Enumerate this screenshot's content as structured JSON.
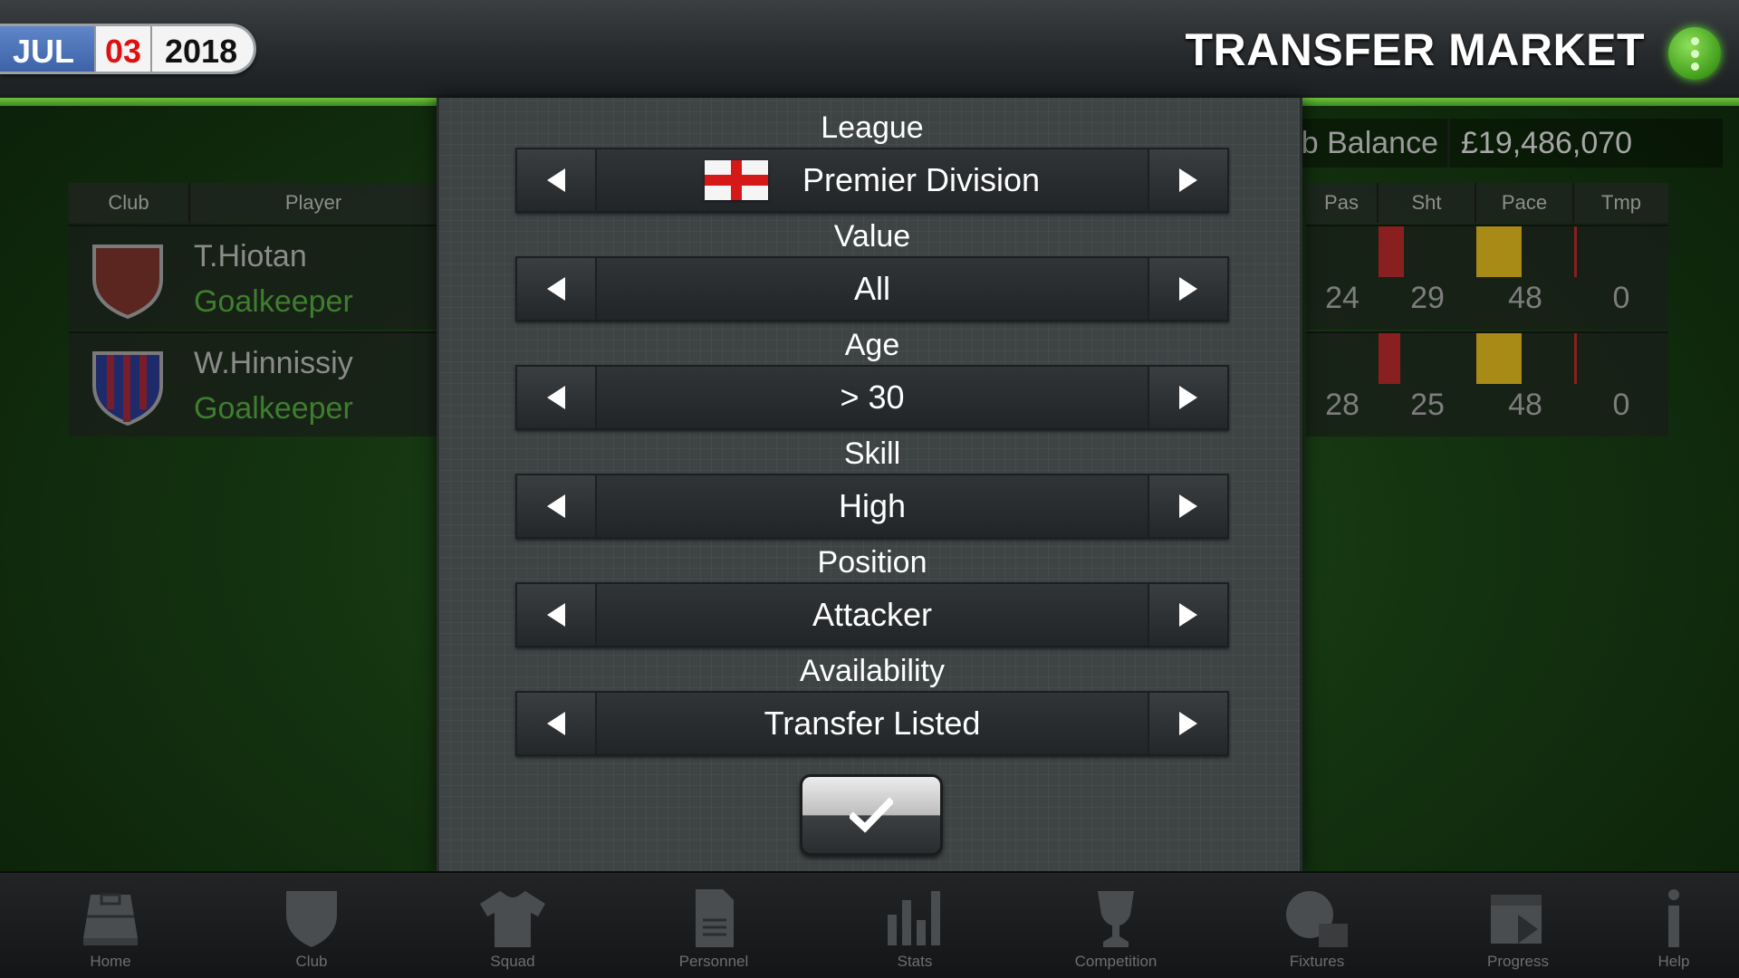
{
  "date": {
    "month": "JUL",
    "day": "03",
    "year": "2018"
  },
  "header": {
    "title": "TRANSFER MARKET",
    "menu_icon": "more-vertical-icon"
  },
  "background": {
    "balance_label": "b Balance",
    "balance_value": "£19,486,070",
    "left_columns": [
      "Club",
      "Player"
    ],
    "right_columns": [
      "Pas",
      "Sht",
      "Pace",
      "Tmp"
    ],
    "players": [
      {
        "name": "T.Hiotan",
        "position": "Goalkeeper",
        "stats": [
          "24",
          "29",
          "48",
          "0"
        ]
      },
      {
        "name": "W.Hinnissiy",
        "position": "Goalkeeper",
        "stats": [
          "28",
          "25",
          "48",
          "0"
        ]
      }
    ],
    "colors": {
      "bar_red": "#8a1f1f",
      "bar_yellow": "#a88a16"
    }
  },
  "filters": [
    {
      "label": "League",
      "value": "Premier Division",
      "flag": "england"
    },
    {
      "label": "Value",
      "value": "All"
    },
    {
      "label": "Age",
      "value": "> 30"
    },
    {
      "label": "Skill",
      "value": "High"
    },
    {
      "label": "Position",
      "value": "Attacker"
    },
    {
      "label": "Availability",
      "value": "Transfer Listed"
    }
  ],
  "confirm_icon": "checkmark-icon",
  "nav": [
    {
      "label": "Home",
      "icon": "pitch-icon"
    },
    {
      "label": "Club",
      "icon": "shield-icon"
    },
    {
      "label": "Squad",
      "icon": "shirt-icon"
    },
    {
      "label": "Personnel",
      "icon": "document-icon"
    },
    {
      "label": "Stats",
      "icon": "bar-chart-icon"
    },
    {
      "label": "Competition",
      "icon": "trophy-icon"
    },
    {
      "label": "Fixtures",
      "icon": "ball-calendar-icon"
    },
    {
      "label": "Progress",
      "icon": "calendar-forward-icon"
    },
    {
      "label": "Help",
      "icon": "info-icon"
    }
  ],
  "accent": "#5fbf36"
}
